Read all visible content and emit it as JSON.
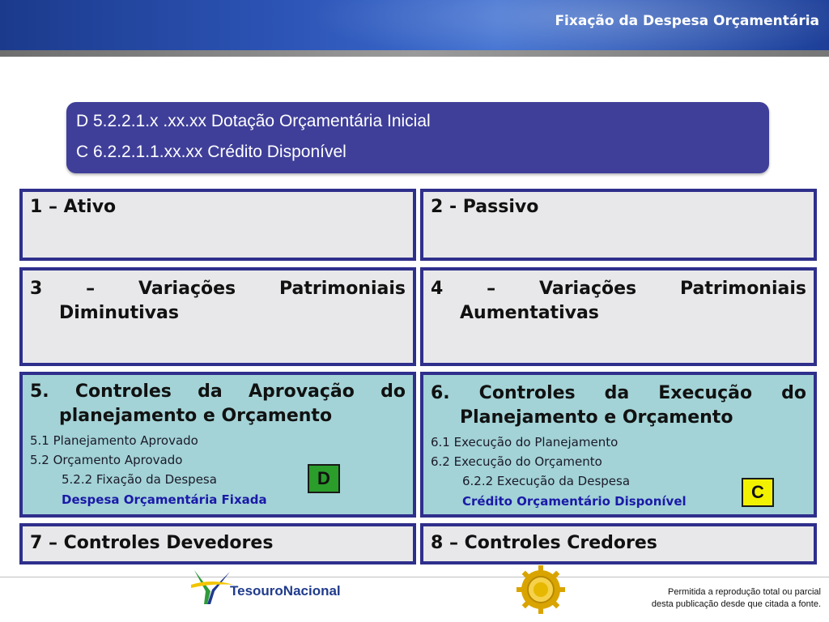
{
  "header": {
    "title": "Fixação da Despesa Orçamentária"
  },
  "entry": {
    "debit": "D 5.2.2.1.x .xx.xx Dotação Orçamentária Inicial",
    "credit": "C 6.2.2.1.1.xx.xx Crédito Disponível"
  },
  "classes": {
    "c1": {
      "title": "1 – Ativo"
    },
    "c2": {
      "title": "2 - Passivo"
    },
    "c3": {
      "title_a": "3 – Variações Patrimoniais",
      "title_b": "Diminutivas"
    },
    "c4": {
      "title_a": "4 – Variações Patrimoniais",
      "title_b": "Aumentativas"
    },
    "c5": {
      "title_a": "5. Controles da Aprovação do",
      "title_b": "planejamento e Orçamento",
      "items": [
        "5.1 Planejamento Aprovado",
        "5.2 Orçamento Aprovado",
        "5.2.2 Fixação da Despesa",
        "Despesa Orçamentária Fixada"
      ],
      "badge": "D"
    },
    "c6": {
      "title_a": "6. Controles da Execução do",
      "title_b": "Planejamento e Orçamento",
      "items": [
        "6.1 Execução do Planejamento",
        "6.2 Execução do Orçamento",
        "6.2.2 Execução da Despesa",
        "Crédito Orçamentário Disponível"
      ],
      "badge": "C"
    },
    "c7": {
      "title": "7 – Controles Devedores"
    },
    "c8": {
      "title": "8 – Controles Credores"
    }
  },
  "footer": {
    "logo_text": "TesouroNacional",
    "note_line1": "Permitida a reprodução total ou parcial",
    "note_line2": "desta publicação desde que citada a fonte."
  },
  "colors": {
    "header": "#2d55b7",
    "entry_box": "#3f3f9a",
    "box_border": "#2f2f8c",
    "box_gray": "#e8e8ea",
    "box_teal": "#a3d3d6",
    "badge_debit": "#2a9d2a",
    "badge_credit": "#f2f200",
    "highlight_text": "#1a1aa8"
  }
}
